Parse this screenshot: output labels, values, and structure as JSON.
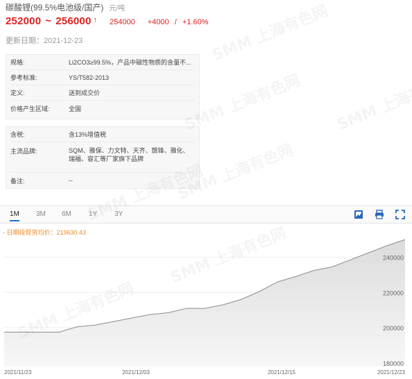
{
  "product": {
    "title": "碳酸锂(99.5%电池级/国产)",
    "unit": "元/吨",
    "price_low": "252000",
    "price_sep": "~",
    "price_high": "256000",
    "average": "254000",
    "change": "+4000",
    "change_sep": "/",
    "change_pct": "+1.60%",
    "update_label": "更新日期",
    "update_date": "2021-12-23"
  },
  "spec_box": [
    {
      "label": "规格:",
      "value": "Li2CO3≥99.5%，产品中磁性物质的含量不..."
    },
    {
      "label": "参考标准:",
      "value": "YS/T582-2013"
    },
    {
      "label": "定义:",
      "value": "送到成交价"
    },
    {
      "label": "价格产生区域:",
      "value": "全国"
    }
  ],
  "trade_box": [
    {
      "label": "含税:",
      "value": "含13%增值税"
    },
    {
      "label": "主流品牌:",
      "value": "SQM、雅保、力文特、天齐、赣锋、雅化、瑞福、容汇等厂家旗下品牌"
    },
    {
      "label": "备注:",
      "value": "--"
    }
  ],
  "tabs": [
    {
      "label": "1M",
      "active": true
    },
    {
      "label": "3M",
      "active": false
    },
    {
      "label": "6M",
      "active": false
    },
    {
      "label": "1Y",
      "active": false
    },
    {
      "label": "3Y",
      "active": false
    }
  ],
  "toolbar": {
    "icons": [
      "image-icon",
      "print-icon",
      "fullscreen-icon"
    ]
  },
  "legend": {
    "text": "日期段现货均价：219630.43"
  },
  "watermark_text": "SMM 上海有色网",
  "colors": {
    "price_red": "#e02020",
    "legend_orange": "#f08a24",
    "tab_active_blue": "#1f6fd1",
    "area_fill": "#e6e6e6",
    "line": "#8c8c8c"
  },
  "chart_data": {
    "type": "area",
    "title": "",
    "xlabel": "",
    "ylabel": "",
    "x_ticks": [
      "2021/11/23",
      "2021/12/03",
      "2021/12/15",
      "2021/12/23"
    ],
    "y_ticks": [
      180000,
      200000,
      220000,
      240000
    ],
    "ylim": [
      178000,
      252000
    ],
    "grid": true,
    "x": [
      "11/23",
      "11/24",
      "11/25",
      "11/26",
      "11/29",
      "11/30",
      "12/01",
      "12/02",
      "12/03",
      "12/06",
      "12/07",
      "12/08",
      "12/09",
      "12/10",
      "12/13",
      "12/14",
      "12/15",
      "12/16",
      "12/17",
      "12/20",
      "12/21",
      "12/22",
      "12/23"
    ],
    "values": [
      197500,
      197500,
      197500,
      197500,
      200500,
      201500,
      203500,
      205500,
      207500,
      208500,
      211000,
      211000,
      213000,
      216000,
      220500,
      226000,
      229000,
      232500,
      234500,
      238500,
      242500,
      246500,
      250000
    ]
  }
}
